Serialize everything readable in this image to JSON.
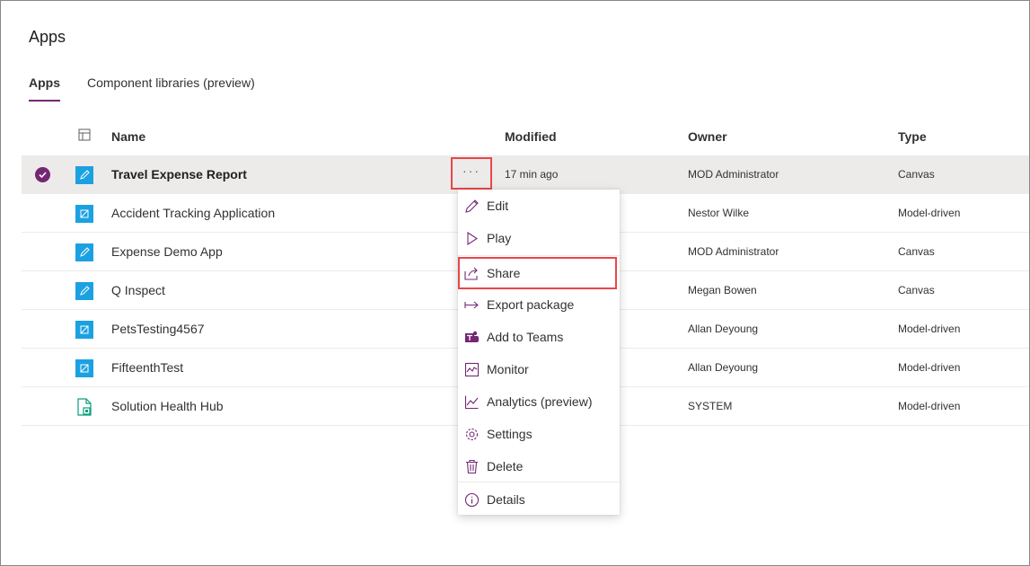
{
  "page": {
    "title": "Apps"
  },
  "tabs": [
    {
      "label": "Apps",
      "active": true
    },
    {
      "label": "Component libraries (preview)",
      "active": false
    }
  ],
  "table": {
    "columns": {
      "name": "Name",
      "modified": "Modified",
      "owner": "Owner",
      "type": "Type"
    },
    "rows": [
      {
        "name": "Travel Expense Report",
        "modified": "17 min ago",
        "owner": "MOD Administrator",
        "type": "Canvas",
        "icon": "canvas-app-icon",
        "selected": true
      },
      {
        "name": "Accident Tracking Application",
        "owner": "Nestor Wilke",
        "type": "Model-driven",
        "icon": "model-driven-app-icon"
      },
      {
        "name": "Expense Demo App",
        "owner": "MOD Administrator",
        "type": "Canvas",
        "icon": "canvas-app-icon"
      },
      {
        "name": "Q Inspect",
        "owner": "Megan Bowen",
        "type": "Canvas",
        "icon": "canvas-app-icon"
      },
      {
        "name": "PetsTesting4567",
        "owner": "Allan Deyoung",
        "type": "Model-driven",
        "icon": "model-driven-app-icon"
      },
      {
        "name": "FifteenthTest",
        "owner": "Allan Deyoung",
        "type": "Model-driven",
        "icon": "model-driven-app-icon"
      },
      {
        "name": "Solution Health Hub",
        "owner": "SYSTEM",
        "type": "Model-driven",
        "icon": "solution-app-icon"
      }
    ]
  },
  "more_button": {
    "label": "···"
  },
  "context_menu": {
    "items": [
      {
        "label": "Edit",
        "icon": "pencil-icon"
      },
      {
        "label": "Play",
        "icon": "play-icon"
      },
      {
        "label": "Share",
        "icon": "share-icon",
        "highlighted": true
      },
      {
        "label": "Export package",
        "icon": "export-icon"
      },
      {
        "label": "Add to Teams",
        "icon": "teams-icon"
      },
      {
        "label": "Monitor",
        "icon": "monitor-icon"
      },
      {
        "label": "Analytics (preview)",
        "icon": "analytics-icon"
      },
      {
        "label": "Settings",
        "icon": "gear-icon"
      },
      {
        "label": "Delete",
        "icon": "trash-icon"
      },
      {
        "label": "Details",
        "icon": "info-icon"
      }
    ]
  },
  "colors": {
    "accent": "#742774",
    "highlight_border": "#e8474a",
    "canvas_icon": "#1ba1e2",
    "selected_row": "#edebe9"
  }
}
